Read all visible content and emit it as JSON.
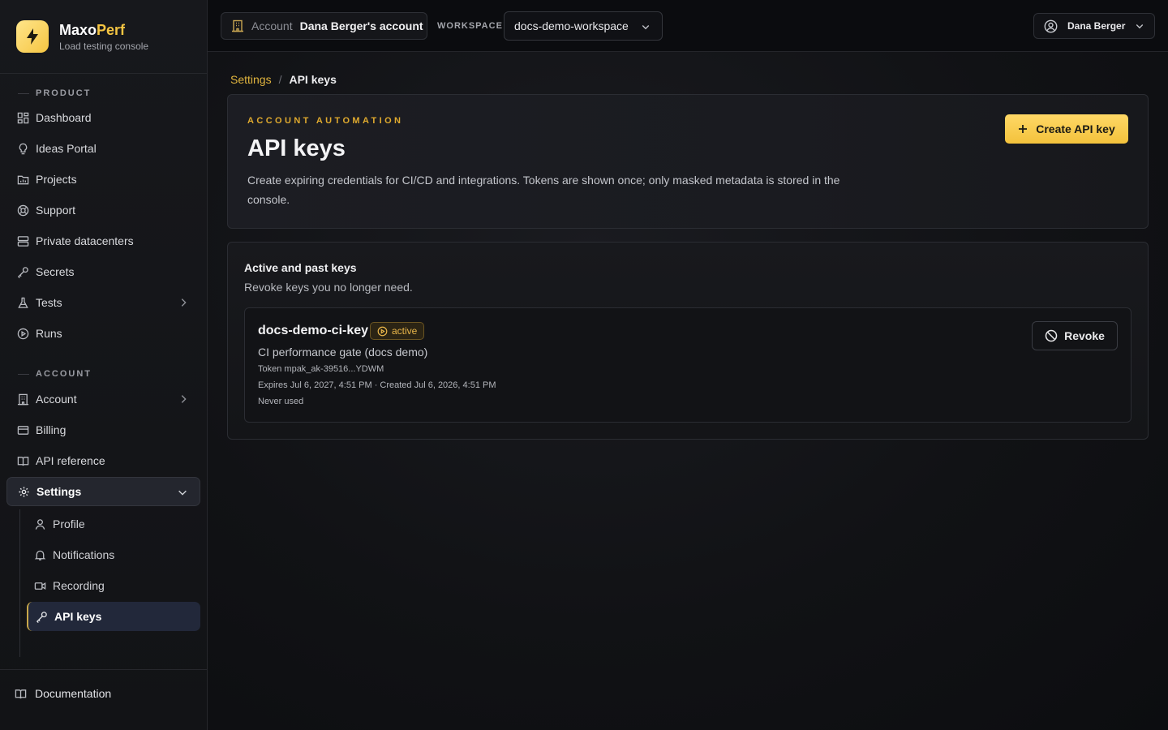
{
  "brand": {
    "name_main": "Maxo",
    "name_accent": "Perf",
    "subtitle": "Load testing console"
  },
  "sidebar": {
    "product_label": "PRODUCT",
    "product_items": [
      {
        "label": "Dashboard",
        "icon": "grid-icon"
      },
      {
        "label": "Ideas Portal",
        "icon": "lightbulb-icon"
      },
      {
        "label": "Projects",
        "icon": "folder-icon"
      },
      {
        "label": "Support",
        "icon": "lifebuoy-icon"
      },
      {
        "label": "Private datacenters",
        "icon": "server-icon"
      },
      {
        "label": "Secrets",
        "icon": "key-icon"
      },
      {
        "label": "Tests",
        "icon": "flask-icon"
      },
      {
        "label": "Runs",
        "icon": "play-circle-icon"
      }
    ],
    "account_label": "ACCOUNT",
    "account_items": [
      {
        "label": "Account",
        "icon": "building-icon"
      },
      {
        "label": "Billing",
        "icon": "credit-card-icon"
      },
      {
        "label": "API reference",
        "icon": "book-icon"
      },
      {
        "label": "Settings",
        "icon": "gear-icon"
      }
    ],
    "settings_sub": [
      {
        "label": "Profile",
        "icon": "user-icon"
      },
      {
        "label": "Notifications",
        "icon": "bell-icon"
      },
      {
        "label": "Recording",
        "icon": "video-icon"
      },
      {
        "label": "API keys",
        "icon": "key-icon"
      }
    ],
    "documentation": "Documentation"
  },
  "topbar": {
    "account_label": "Account",
    "account_value": "Dana Berger's account",
    "workspace_label": "WORKSPACE",
    "workspace_value": "docs-demo-workspace",
    "user_name": "Dana Berger"
  },
  "breadcrumb": {
    "parent": "Settings",
    "separator": "/",
    "current": "API keys"
  },
  "hero": {
    "eyebrow": "ACCOUNT AUTOMATION",
    "title": "API keys",
    "description": "Create expiring credentials for CI/CD and integrations. Tokens are shown once; only masked metadata is stored in the console.",
    "create_button": "Create API key"
  },
  "keys": {
    "title": "Active and past keys",
    "subtitle": "Revoke keys you no longer need.",
    "items": [
      {
        "name": "docs-demo-ci-key",
        "status": "active",
        "description": "CI performance gate (docs demo)",
        "token": "Token mpak_ak-39516...YDWM",
        "dates": "Expires Jul 6, 2027, 4:51 PM · Created Jul 6, 2026, 4:51 PM",
        "usage": "Never used",
        "revoke_label": "Revoke"
      }
    ]
  },
  "colors": {
    "accent": "#f5c542",
    "active_badge": "#e9b64a",
    "background": "#0d0e11"
  }
}
